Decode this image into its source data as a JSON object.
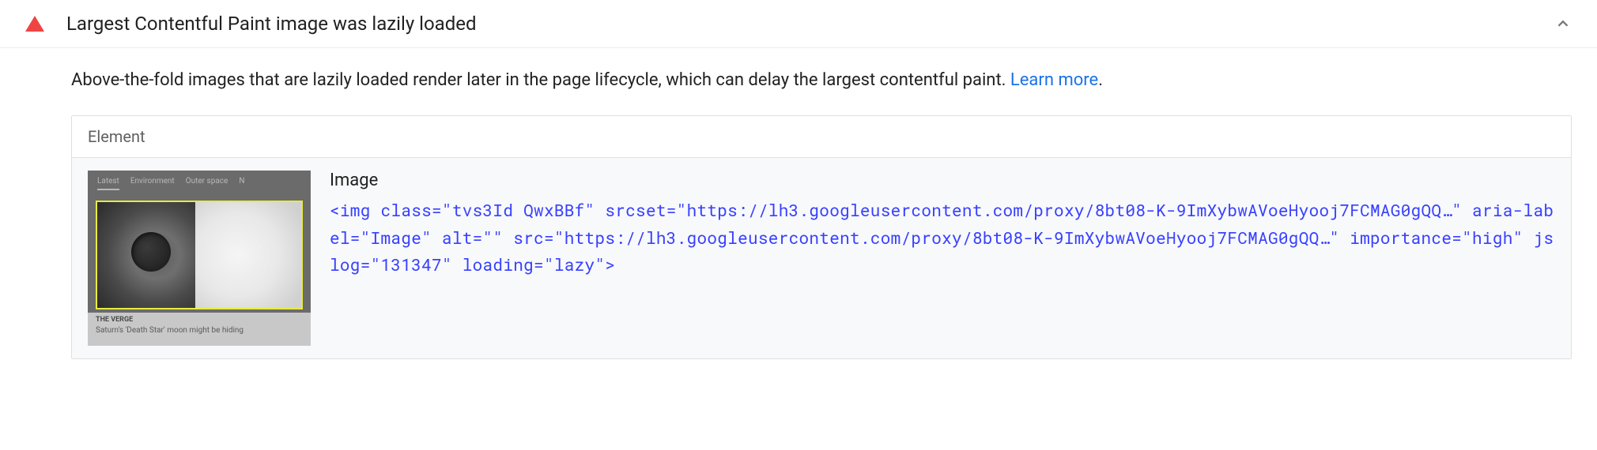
{
  "audit": {
    "title": "Largest Contentful Paint image was lazily loaded",
    "description_prefix": "Above-the-fold images that are lazily loaded render later in the page lifecycle, which can delay the largest contentful paint. ",
    "learn_more_label": "Learn more",
    "description_suffix": "."
  },
  "table": {
    "header": "Element",
    "row": {
      "label": "Image",
      "code": "<img class=\"tvs3Id QwxBBf\" srcset=\"https://lh3.googleusercontent.com/proxy/8bt08-K-9ImXybwAVoeHyooj7FCMAG0gQQ…\" aria-label=\"Image\" alt=\"\" src=\"https://lh3.googleusercontent.com/proxy/8bt08-K-9ImXybwAVoeHyooj7FCMAG0gQQ…\" importance=\"high\" jslog=\"131347\" loading=\"lazy\">"
    }
  },
  "thumbnail": {
    "nav": {
      "item1": "Latest",
      "item2": "Environment",
      "item3": "Outer space",
      "item4": "N"
    },
    "source": "THE VERGE",
    "caption": "Saturn's 'Death Star' moon might be hiding"
  }
}
